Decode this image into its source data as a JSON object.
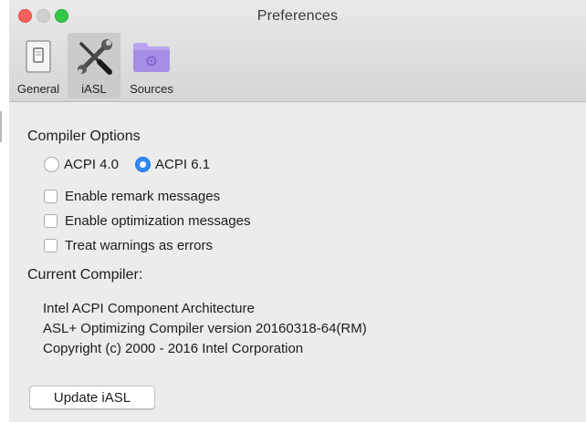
{
  "window": {
    "title": "Preferences"
  },
  "toolbar": {
    "items": [
      {
        "label": "General",
        "icon": "switch-icon",
        "selected": false
      },
      {
        "label": "iASL",
        "icon": "tools-icon",
        "selected": true
      },
      {
        "label": "Sources",
        "icon": "folder-icon",
        "selected": false
      }
    ]
  },
  "compiler_options": {
    "title": "Compiler Options",
    "acpi_options": [
      {
        "label": "ACPI 4.0",
        "selected": false
      },
      {
        "label": "ACPI 6.1",
        "selected": true
      }
    ],
    "checkboxes": [
      {
        "label": "Enable remark messages",
        "checked": false
      },
      {
        "label": "Enable optimization messages",
        "checked": false
      },
      {
        "label": "Treat warnings as errors",
        "checked": false
      }
    ]
  },
  "current_compiler": {
    "title": "Current Compiler:",
    "lines": [
      "Intel ACPI Component Architecture",
      "ASL+ Optimizing Compiler version 20160318-64(RM)",
      "Copyright (c) 2000 - 2016 Intel Corporation"
    ]
  },
  "update_button": {
    "label": "Update iASL"
  },
  "colors": {
    "accent": "#2f89f6",
    "close": "#fc605c",
    "zoom": "#34c84a",
    "folder": "#a58fe6"
  }
}
